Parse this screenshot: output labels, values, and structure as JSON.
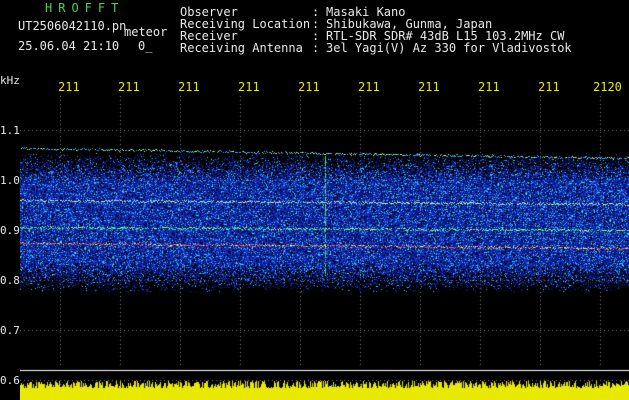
{
  "header": {
    "title": "HROFFT",
    "filename": "UT2506042110.pn",
    "tag": "meteor",
    "date": "25.06.04 21:10",
    "count": "0_",
    "fields": [
      {
        "label": "Observer",
        "value": "Masaki Kano"
      },
      {
        "label": "Receiving Location",
        "value": "Shibukawa, Gunma, Japan"
      },
      {
        "label": "Receiver",
        "value": "RTL-SDR SDR# 43dB L15 103.2MHz CW"
      },
      {
        "label": "Receiving Antenna",
        "value": "3el Yagi(V) Az 330 for Vladivostok"
      }
    ],
    "separator": ":"
  },
  "axes": {
    "unit": "kHz",
    "time_ticks": [
      "211",
      "211",
      "211",
      "211",
      "211",
      "211",
      "211",
      "211",
      "211",
      "2120"
    ],
    "freq_ticks": [
      "1.1",
      "1.0",
      "0.9",
      "0.8",
      "0.7",
      "0.6"
    ]
  },
  "colors": {
    "background": "#000000",
    "header_title": "#4cd44c",
    "header_text": "#e8e8e8",
    "axis_text": "#e8e800",
    "noise_floor": "#e8e800"
  }
}
